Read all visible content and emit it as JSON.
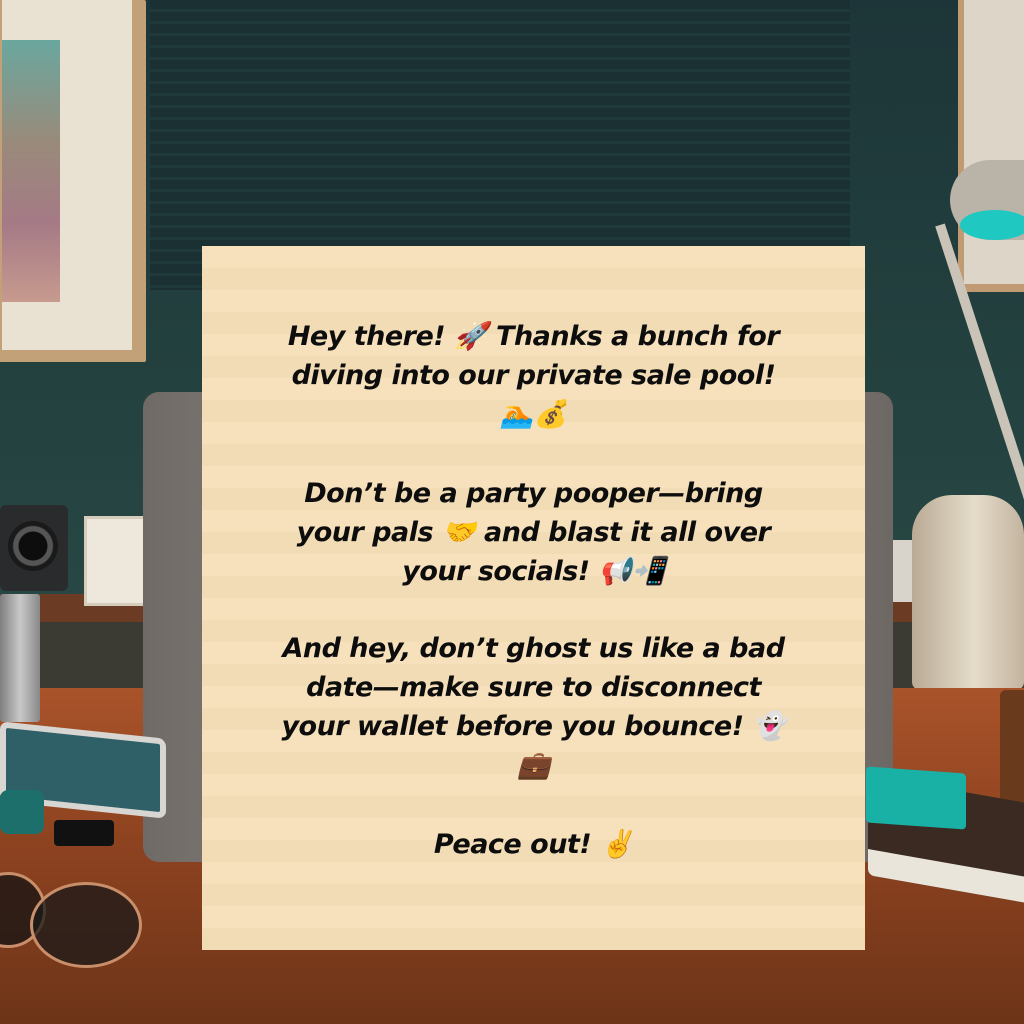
{
  "message": {
    "paragraph_1": "Hey there! 🚀 Thanks a bunch for\ndiving into our private sale pool!\n🏊💰",
    "paragraph_2": "Don’t be a party pooper—bring\nyour pals 🤝 and blast it all over\nyour socials! 📢📲",
    "paragraph_3": "And hey, don’t ghost us like a bad\ndate—make sure to disconnect\nyour wallet before you bounce! 👻\n💼",
    "paragraph_4": "Peace out! ✌️"
  },
  "colors": {
    "card_background": "#f5dfb8",
    "text": "#0d0d0d",
    "desk": "#a9532a",
    "wall": "#1f3a3c"
  }
}
